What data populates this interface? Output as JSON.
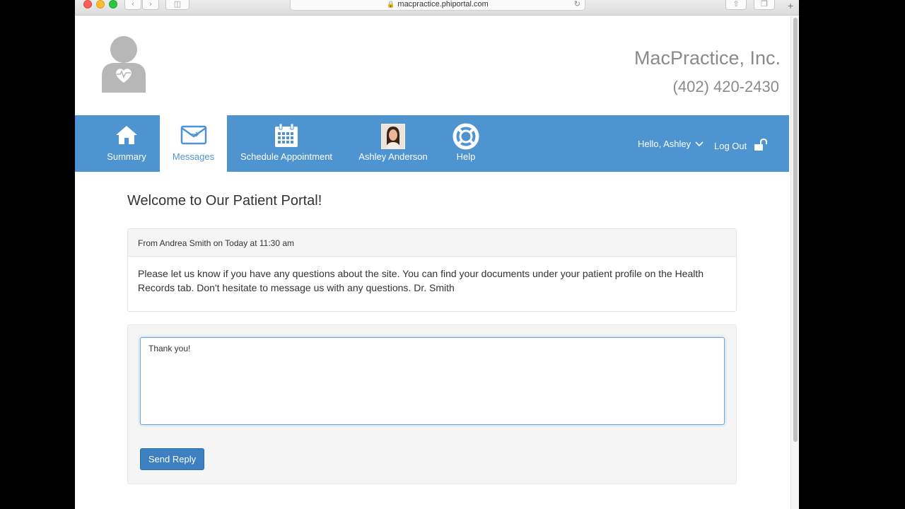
{
  "browser": {
    "url": "macpractice.phiportal.com"
  },
  "header": {
    "practice_name": "MacPractice, Inc.",
    "phone": "(402) 420-2430"
  },
  "nav": {
    "items": [
      {
        "label": "Summary",
        "icon": "home-icon"
      },
      {
        "label": "Messages",
        "icon": "envelope-icon"
      },
      {
        "label": "Schedule Appointment",
        "icon": "calendar-icon"
      },
      {
        "label": "Ashley Anderson",
        "icon": "profile-photo"
      },
      {
        "label": "Help",
        "icon": "lifebuoy-icon"
      }
    ],
    "active": "Messages",
    "user_greeting": "Hello, Ashley",
    "logout_label": "Log Out"
  },
  "page": {
    "title": "Welcome to Our Patient Portal!",
    "message": {
      "header": "From Andrea Smith on Today at 11:30 am",
      "body": "Please let us know if you have any questions about the site. You can find your documents under your patient profile on the Health Records tab. Don't hesitate to message us with any questions. Dr. Smith"
    },
    "reply": {
      "value": "Thank you!",
      "button_label": "Send Reply"
    }
  },
  "colors": {
    "nav_bg": "#4e94d0",
    "button_bg": "#3d80c1",
    "header_text": "#8a8a8a"
  }
}
